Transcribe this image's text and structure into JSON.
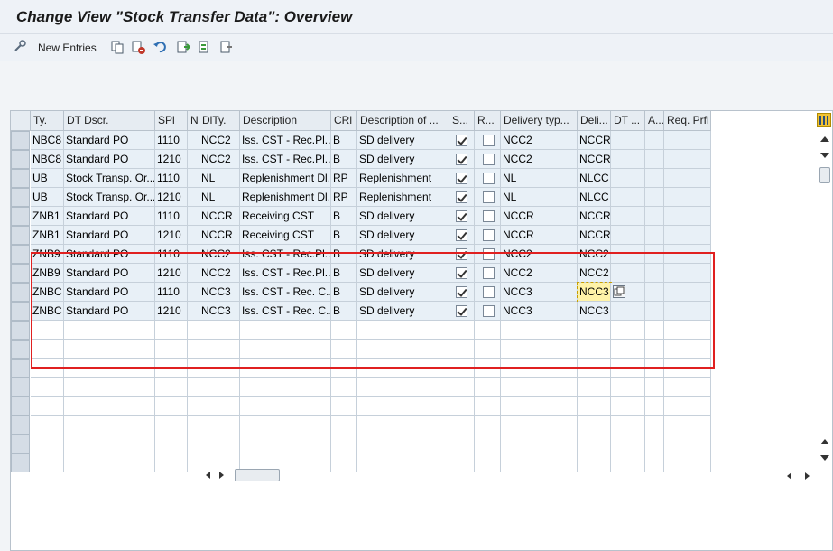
{
  "title": "Change View \"Stock Transfer Data\": Overview",
  "toolbar": {
    "new_entries_label": "New Entries"
  },
  "columns": [
    "Ty.",
    "DT Dscr.",
    "SPl",
    "N",
    "DlTy.",
    "Description",
    "CRl",
    "Description of ...",
    "S...",
    "R...",
    "Delivery typ...",
    "Deli...",
    "DT ...",
    "A...",
    "Req. Prfl"
  ],
  "rows": [
    {
      "ty": "NBC8",
      "dt": "Standard PO",
      "spl": "1110",
      "n": "",
      "dlty": "NCC2",
      "desc": "Iss. CST - Rec.Pl...",
      "crl": "B",
      "desc2": "SD delivery",
      "s": true,
      "r": false,
      "deltyp": "NCC2",
      "deli": "NCCR"
    },
    {
      "ty": "NBC8",
      "dt": "Standard PO",
      "spl": "1210",
      "n": "",
      "dlty": "NCC2",
      "desc": "Iss. CST - Rec.Pl...",
      "crl": "B",
      "desc2": "SD delivery",
      "s": true,
      "r": false,
      "deltyp": "NCC2",
      "deli": "NCCR"
    },
    {
      "ty": "UB",
      "dt": "Stock Transp. Or...",
      "spl": "1110",
      "n": "",
      "dlty": "NL",
      "desc": "Replenishment Dl...",
      "crl": "RP",
      "desc2": "Replenishment",
      "s": true,
      "r": false,
      "deltyp": "NL",
      "deli": "NLCC"
    },
    {
      "ty": "UB",
      "dt": "Stock Transp. Or...",
      "spl": "1210",
      "n": "",
      "dlty": "NL",
      "desc": "Replenishment Dl...",
      "crl": "RP",
      "desc2": "Replenishment",
      "s": true,
      "r": false,
      "deltyp": "NL",
      "deli": "NLCC"
    },
    {
      "ty": "ZNB1",
      "dt": "Standard PO",
      "spl": "1110",
      "n": "",
      "dlty": "NCCR",
      "desc": "Receiving CST",
      "crl": "B",
      "desc2": "SD delivery",
      "s": true,
      "r": false,
      "deltyp": "NCCR",
      "deli": "NCCR"
    },
    {
      "ty": "ZNB1",
      "dt": "Standard PO",
      "spl": "1210",
      "n": "",
      "dlty": "NCCR",
      "desc": "Receiving CST",
      "crl": "B",
      "desc2": "SD delivery",
      "s": true,
      "r": false,
      "deltyp": "NCCR",
      "deli": "NCCR"
    },
    {
      "ty": "ZNB9",
      "dt": "Standard PO",
      "spl": "1110",
      "n": "",
      "dlty": "NCC2",
      "desc": "Iss. CST - Rec.Pl...",
      "crl": "B",
      "desc2": "SD delivery",
      "s": true,
      "r": false,
      "deltyp": "NCC2",
      "deli": "NCC2"
    },
    {
      "ty": "ZNB9",
      "dt": "Standard PO",
      "spl": "1210",
      "n": "",
      "dlty": "NCC2",
      "desc": "Iss. CST - Rec.Pl...",
      "crl": "B",
      "desc2": "SD delivery",
      "s": true,
      "r": false,
      "deltyp": "NCC2",
      "deli": "NCC2"
    },
    {
      "ty": "ZNBC",
      "dt": "Standard PO",
      "spl": "1110",
      "n": "",
      "dlty": "NCC3",
      "desc": "Iss. CST - Rec. C...",
      "crl": "B",
      "desc2": "SD delivery",
      "s": true,
      "r": false,
      "deltyp": "NCC3",
      "deli": "NCC3"
    },
    {
      "ty": "ZNBC",
      "dt": "Standard PO",
      "spl": "1210",
      "n": "",
      "dlty": "NCC3",
      "desc": "Iss. CST - Rec. C...",
      "crl": "B",
      "desc2": "SD delivery",
      "s": true,
      "r": false,
      "deltyp": "NCC3",
      "deli": "NCC3"
    }
  ],
  "empty_rows": 8,
  "colors": {
    "highlight": "#e02020",
    "focus_cell": "#fff3a8"
  },
  "icons": [
    "customize-icon",
    "copy-icon",
    "delete-icon",
    "undo-icon",
    "select-all-icon",
    "select-block-icon",
    "deselect-all-icon",
    "table-settings-icon"
  ]
}
